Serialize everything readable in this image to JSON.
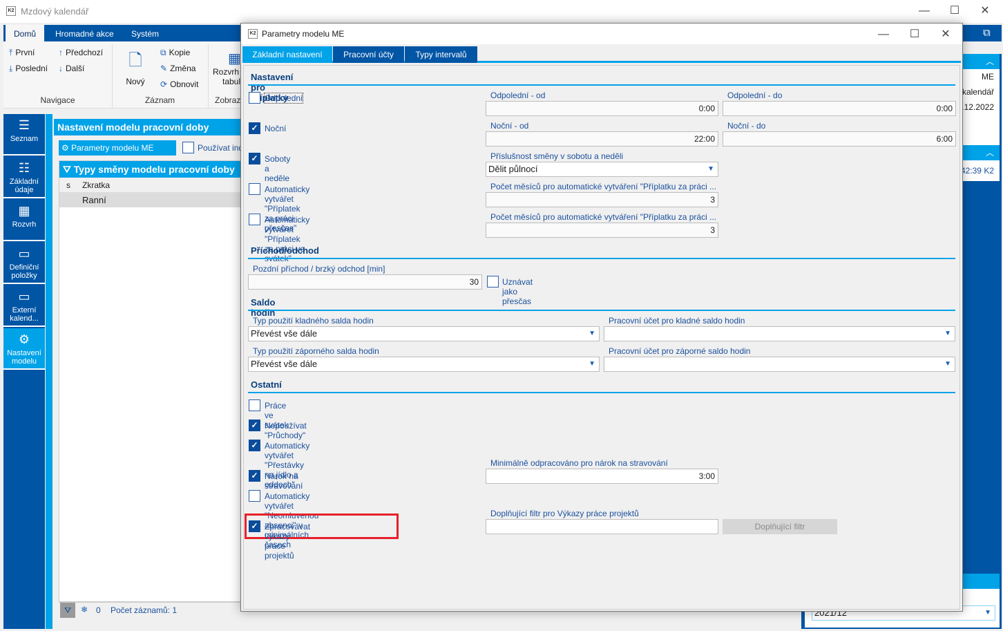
{
  "window": {
    "title": "Mzdový kalendář",
    "logo": "K2",
    "minimize": "—",
    "maximize": "☐",
    "close": "✕"
  },
  "ribbon": {
    "tabs": [
      "Domů",
      "Hromadné akce",
      "Systém"
    ],
    "nav": {
      "first": "První",
      "prev": "Předchozí",
      "last": "Poslední",
      "next": "Další",
      "group": "Navigace"
    },
    "record": {
      "new": "Nový",
      "copy": "Kopie",
      "change": "Změna",
      "refresh": "Obnovit",
      "group": "Záznam"
    },
    "view": {
      "schedule": "Rozvrh",
      "table": "tabul",
      "group": "Zobraz"
    }
  },
  "sidebar": {
    "items": [
      {
        "label": "Seznam",
        "icon": "list-icon"
      },
      {
        "label": "Základní údaje",
        "icon": "bullet-list-icon"
      },
      {
        "label": "Rozvrh",
        "icon": "calendar-icon"
      },
      {
        "label": "Definiční položky",
        "icon": "box-icon"
      },
      {
        "label": "Externí kalend...",
        "icon": "box-icon"
      },
      {
        "label": "Nastavení modelu",
        "icon": "gear-icon",
        "active": true
      }
    ]
  },
  "main": {
    "header": "Nastavení modelu pracovní doby",
    "params_button": "Parametry modelu ME",
    "use_checkbox": "Používat ind",
    "grid": {
      "title": "Typy směny modelu pracovní doby",
      "columns": [
        "s",
        "Zkratka"
      ],
      "rows": [
        [
          "",
          "Ranní"
        ]
      ]
    },
    "status": {
      "count_zero": "0",
      "records": "Počet záznamů: 1"
    }
  },
  "right_panel": {
    "values": [
      "ME",
      "kalendář",
      ".12.2022",
      "42:39 K2",
      "2021/12"
    ]
  },
  "dialog": {
    "title": "Parametry modelu ME",
    "tabs": [
      "Základní nastavení",
      "Pracovní účty",
      "Typy intervalů"
    ],
    "sec1": {
      "title": "Nastavení pro příplatky",
      "afternoon": {
        "label": "Odpolední",
        "checked": false
      },
      "night": {
        "label": "Noční",
        "checked": true
      },
      "weekend": {
        "label": "Soboty a neděle",
        "checked": true
      },
      "auto_overtime": {
        "label": "Automaticky vytvářet \"Příplatek za práci přesčas\"",
        "checked": false
      },
      "auto_holiday": {
        "label": "Automaticky vytvářet \"Příplatek za práci ve svátek\"",
        "checked": false
      },
      "aft_from": {
        "label": "Odpolední - od",
        "value": "0:00"
      },
      "aft_to": {
        "label": "Odpolední - do",
        "value": "0:00"
      },
      "night_from": {
        "label": "Noční - od",
        "value": "22:00"
      },
      "night_to": {
        "label": "Noční - do",
        "value": "6:00"
      },
      "weekend_shift": {
        "label": "Příslušnost směny v sobotu a neděli",
        "value": "Dělit půlnocí"
      },
      "months1": {
        "label": "Počet měsíců pro automatické vytváření \"Příplatku za práci ...",
        "value": "3"
      },
      "months2": {
        "label": "Počet měsíců pro automatické vytváření \"Příplatku za práci ...",
        "value": "3"
      }
    },
    "sec2": {
      "title": "Příchod/odchod",
      "late": {
        "label": "Pozdní příchod / brzký odchod [min]",
        "value": "30"
      },
      "as_overtime": {
        "label": "Uznávat jako přesčas",
        "checked": false
      }
    },
    "sec3": {
      "title": "Saldo hodin",
      "pos_type": {
        "label": "Typ použití kladného salda hodin",
        "value": "Převést vše dále"
      },
      "pos_acc": {
        "label": "Pracovní účet pro kladné saldo hodin",
        "value": ""
      },
      "neg_type": {
        "label": "Typ použití záporného salda hodin",
        "value": "Převést vše dále"
      },
      "neg_acc": {
        "label": "Pracovní účet pro záporné saldo hodin",
        "value": ""
      }
    },
    "sec4": {
      "title": "Ostatní",
      "holiday_work": {
        "label": "Práce ve svátek",
        "checked": false
      },
      "no_passes": {
        "label": "Nepoužívat \"Průchody\"",
        "checked": true
      },
      "auto_breaks": {
        "label": "Automaticky vytvářet \"Přestávky na jídlo a oddech\"",
        "checked": true
      },
      "meal": {
        "label": "Nárok na stravování",
        "checked": true
      },
      "min_meal": {
        "label": "Minimálně odpracováno pro nárok na stravování",
        "value": "3:00"
      },
      "auto_absence": {
        "label": "Automaticky vytvářet \"Neomluvenou absenci\" v minimálních časech",
        "checked": false
      },
      "projects": {
        "label": "Zpracovávat výkazy práce projektů",
        "checked": true
      },
      "proj_filter": {
        "label": "Doplňující filtr pro Výkazy práce projektů",
        "value": ""
      },
      "filter_button": "Doplňující filtr"
    }
  },
  "colors": {
    "dark_blue": "#0055a5",
    "accent": "#00a2e8",
    "highlight": "#e8202a"
  }
}
